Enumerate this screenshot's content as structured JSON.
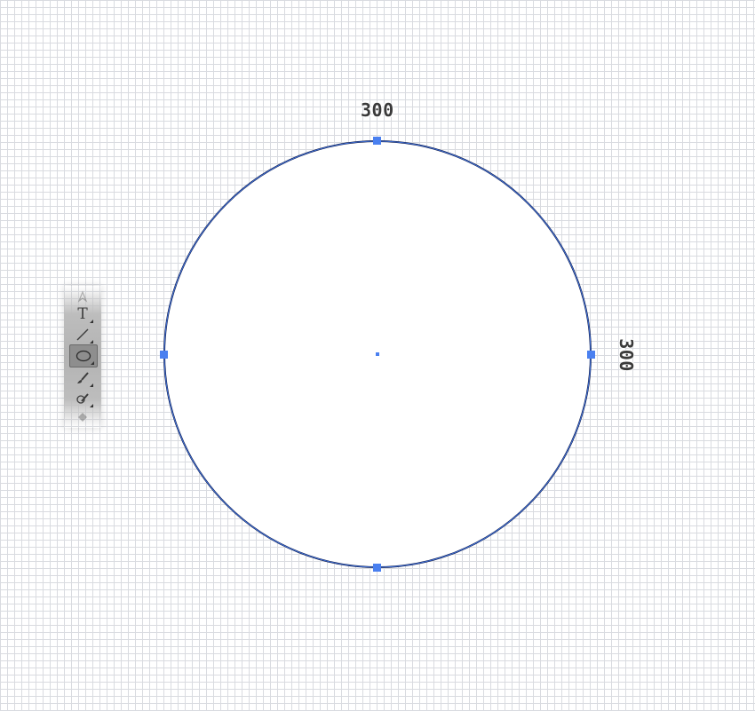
{
  "canvas": {
    "background": "#ffffff",
    "grid_color": "#d9dbe0"
  },
  "shape": {
    "type": "ellipse",
    "stroke_color": "#0d1a4a",
    "selection_color": "#4a80f0",
    "width_label": "300",
    "height_label": "300"
  },
  "toolbar": {
    "tools": [
      {
        "name": "pen-tool",
        "icon": "pen-icon"
      },
      {
        "name": "type-tool",
        "icon": "type-icon",
        "glyph": "T"
      },
      {
        "name": "line-tool",
        "icon": "line-icon"
      },
      {
        "name": "ellipse-tool",
        "icon": "ellipse-icon",
        "active": true
      },
      {
        "name": "brush-tool",
        "icon": "brush-icon"
      },
      {
        "name": "eraser-tool",
        "icon": "eraser-icon"
      },
      {
        "name": "fill-tool",
        "icon": "fill-icon"
      }
    ]
  }
}
